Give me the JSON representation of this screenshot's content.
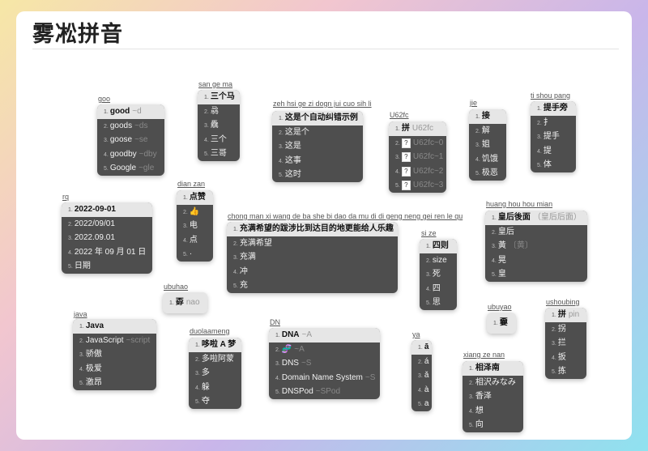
{
  "title": "雾凇拼音",
  "demos": [
    {
      "input": "goo",
      "candidates": [
        {
          "text": "good",
          "comment": "~d"
        },
        {
          "text": "goods",
          "comment": "~ds"
        },
        {
          "text": "goose",
          "comment": "~se"
        },
        {
          "text": "goodby",
          "comment": "~dby"
        },
        {
          "text": "Google",
          "comment": "~gle"
        }
      ]
    },
    {
      "input": "san ge ma",
      "candidates": [
        {
          "text": "三个马"
        },
        {
          "text": "骉"
        },
        {
          "text": "驫"
        },
        {
          "text": "三个"
        },
        {
          "text": "三哥"
        }
      ]
    },
    {
      "input": "zeh hsi ge zi dogn jui cuo sih li",
      "candidates": [
        {
          "text": "这是个自动纠错示例"
        },
        {
          "text": "这是个"
        },
        {
          "text": "这是"
        },
        {
          "text": "这事"
        },
        {
          "text": "这时"
        }
      ]
    },
    {
      "input": "U62fc",
      "candidates": [
        {
          "text": "拼",
          "comment": "U62fc"
        },
        {
          "text": "?",
          "comment": "U62fc~0",
          "box": true
        },
        {
          "text": "?",
          "comment": "U62fc~1",
          "box": true
        },
        {
          "text": "?",
          "comment": "U62fc~2",
          "box": true
        },
        {
          "text": "?",
          "comment": "U62fc~3",
          "box": true
        }
      ]
    },
    {
      "input": "jie",
      "candidates": [
        {
          "text": "接"
        },
        {
          "text": "解"
        },
        {
          "text": "姐"
        },
        {
          "text": "饥饿"
        },
        {
          "text": "极恶"
        }
      ]
    },
    {
      "input": "ti shou pang",
      "candidates": [
        {
          "text": "提手旁"
        },
        {
          "text": "扌"
        },
        {
          "text": "提手"
        },
        {
          "text": "提"
        },
        {
          "text": "体"
        }
      ]
    },
    {
      "input": "rq",
      "candidates": [
        {
          "text": "2022-09-01"
        },
        {
          "text": "2022/09/01"
        },
        {
          "text": "2022.09.01"
        },
        {
          "text": "2022 年 09 月 01 日"
        },
        {
          "text": "日期"
        }
      ]
    },
    {
      "input": "dian zan",
      "candidates": [
        {
          "text": "点赞"
        },
        {
          "text": "👍"
        },
        {
          "text": "电"
        },
        {
          "text": "点"
        },
        {
          "text": "·"
        }
      ]
    },
    {
      "input": "chong man xi wang de ba she bi dao da mu di di geng neng gei ren le qu",
      "candidates": [
        {
          "text": "充满希望的跋涉比到达目的地更能给人乐趣"
        },
        {
          "text": "充满希望"
        },
        {
          "text": "充满"
        },
        {
          "text": "冲"
        },
        {
          "text": "充"
        }
      ]
    },
    {
      "input": "si ze",
      "candidates": [
        {
          "text": "四则"
        },
        {
          "text": "size"
        },
        {
          "text": "死"
        },
        {
          "text": "四"
        },
        {
          "text": "思"
        }
      ]
    },
    {
      "input": "huang hou hou mian",
      "candidates": [
        {
          "text": "皇后後面",
          "comment": "（皇后后面）"
        },
        {
          "text": "皇后"
        },
        {
          "text": "黃",
          "comment": "〔黄〕"
        },
        {
          "text": "晃"
        },
        {
          "text": "皇"
        }
      ]
    },
    {
      "input": "ubuhao",
      "candidates": [
        {
          "text": "孬",
          "comment": "nao"
        }
      ]
    },
    {
      "input": "java",
      "candidates": [
        {
          "text": "Java"
        },
        {
          "text": "JavaScript",
          "comment": "~script"
        },
        {
          "text": "骄傲"
        },
        {
          "text": "极爱"
        },
        {
          "text": "激昂"
        }
      ]
    },
    {
      "input": "duolaameng",
      "candidates": [
        {
          "text": "哆啦 A 梦"
        },
        {
          "text": "多啦阿蒙"
        },
        {
          "text": "多"
        },
        {
          "text": "躲"
        },
        {
          "text": "夺"
        }
      ]
    },
    {
      "input": "DN",
      "candidates": [
        {
          "text": "DNA",
          "comment": "~A"
        },
        {
          "text": "🧬",
          "comment": "~A"
        },
        {
          "text": "DNS",
          "comment": "~S"
        },
        {
          "text": "Domain Name System",
          "comment": "~S"
        },
        {
          "text": "DNSPod",
          "comment": "~SPod"
        }
      ]
    },
    {
      "input": "ya",
      "candidates": [
        {
          "text": "ā"
        },
        {
          "text": "á"
        },
        {
          "text": "ǎ"
        },
        {
          "text": "à"
        },
        {
          "text": "a"
        }
      ]
    },
    {
      "input": "ubuyao",
      "candidates": [
        {
          "text": "嫑"
        }
      ]
    },
    {
      "input": "ushoubing",
      "candidates": [
        {
          "text": "拼",
          "comment": "pin"
        },
        {
          "text": "拐"
        },
        {
          "text": "拦"
        },
        {
          "text": "扳"
        },
        {
          "text": "拣"
        }
      ]
    },
    {
      "input": "xiang ze nan",
      "candidates": [
        {
          "text": "相泽南"
        },
        {
          "text": "相沢みなみ"
        },
        {
          "text": "香泽"
        },
        {
          "text": "想"
        },
        {
          "text": "向"
        }
      ]
    }
  ]
}
